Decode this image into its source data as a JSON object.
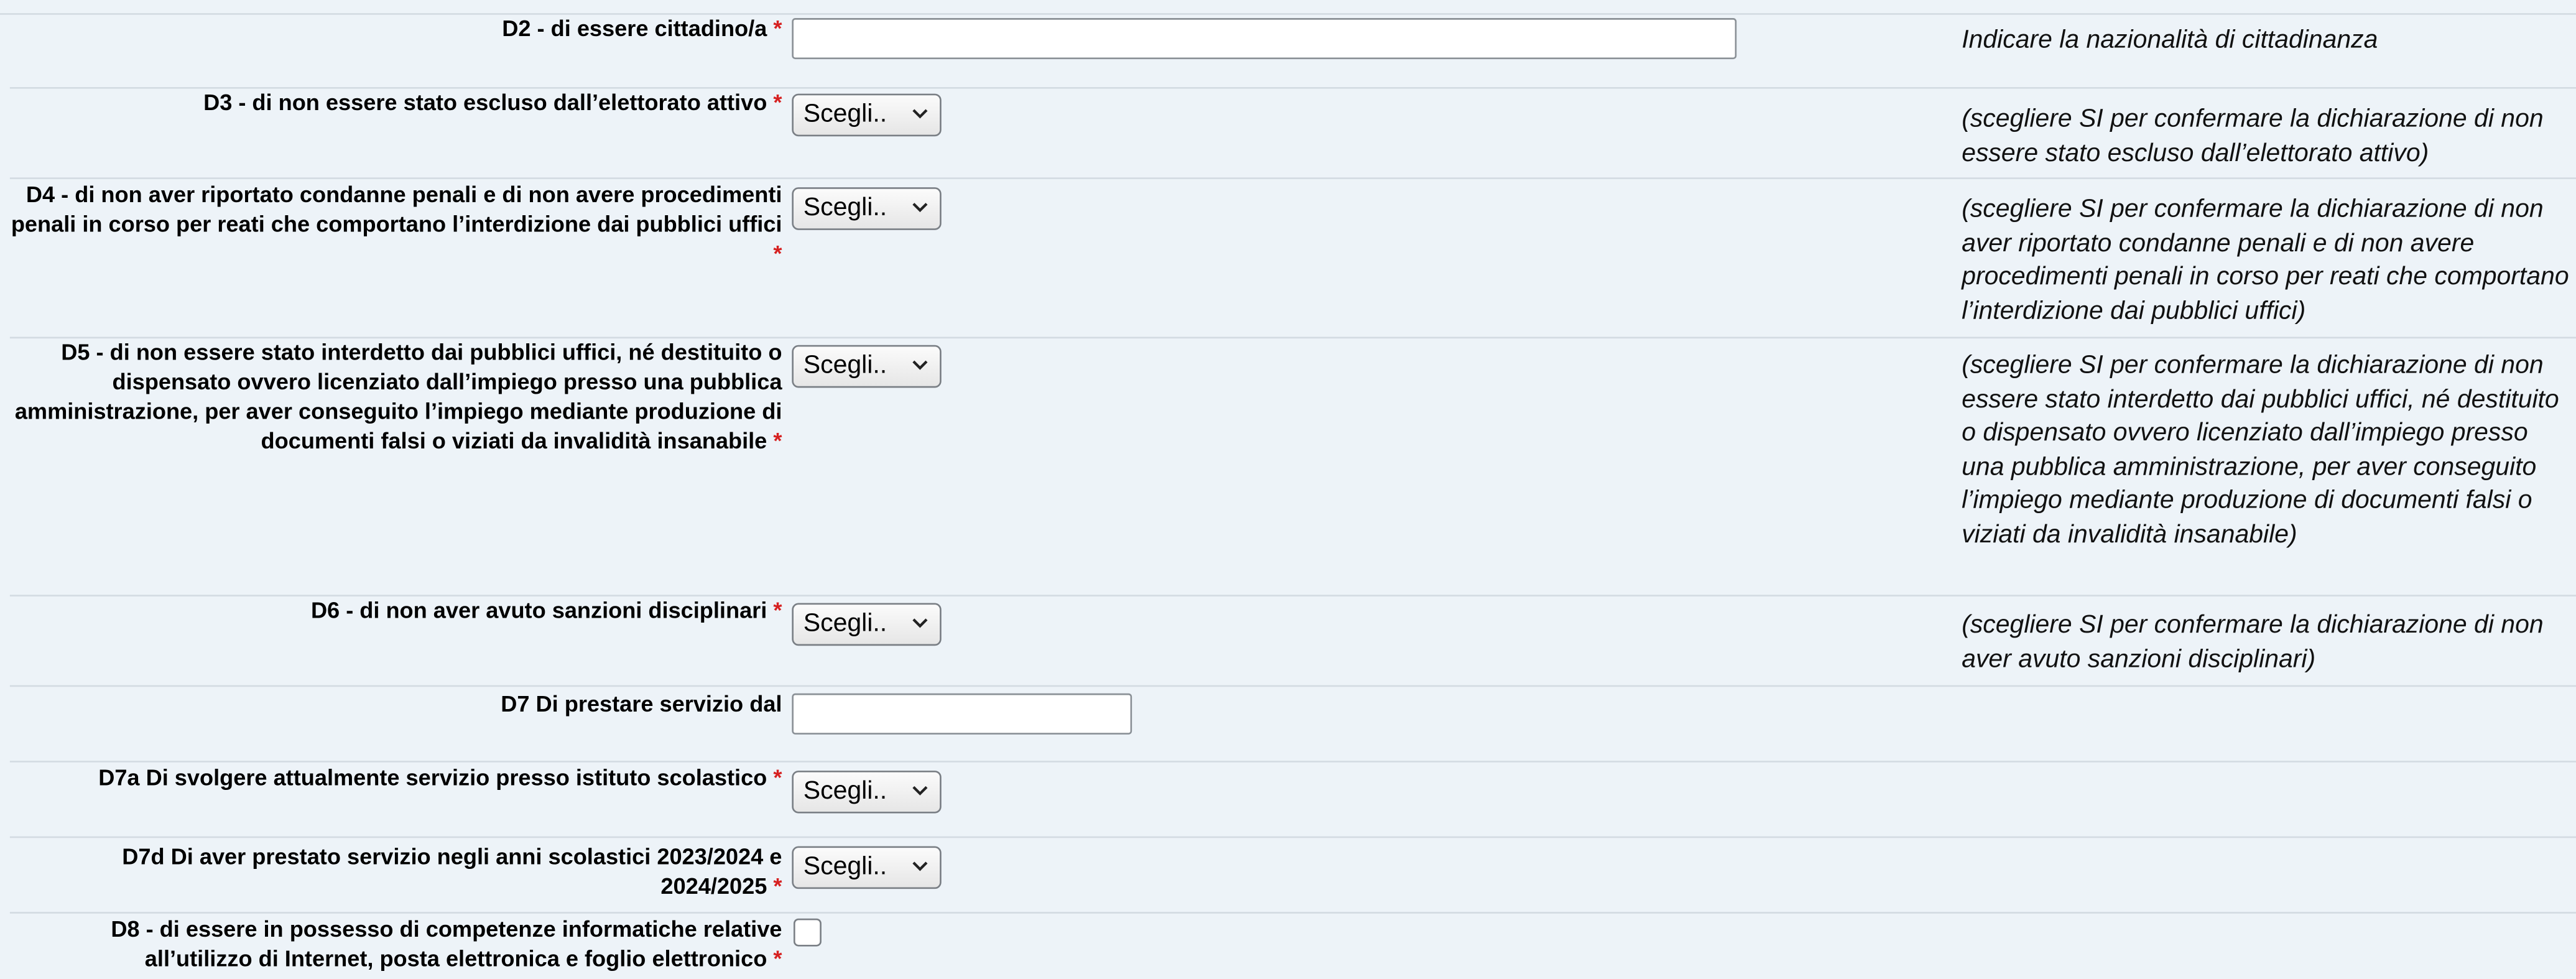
{
  "rows": [
    {
      "label": "D2 - di essere cittadino/a",
      "required": "*",
      "hint": "Indicare la nazionalità di cittadinanza",
      "input_value": ""
    },
    {
      "label": "D3 - di non essere stato escluso dall’elettorato attivo",
      "required": "*",
      "hint": "(scegliere SI per confermare la dichiarazione di non essere stato escluso dall’elettorato attivo)",
      "select_value": "Scegli.."
    },
    {
      "label": "D4 - di non aver riportato condanne penali e di non avere procedimenti penali in corso per reati che comportano l’interdizione dai pubblici uffici",
      "required": "*",
      "hint": "(scegliere SI per confermare la dichiarazione di non aver riportato condanne penali e di non avere procedimenti penali in corso per reati che comportano l’interdizione dai pubblici uffici)",
      "select_value": "Scegli.."
    },
    {
      "label": "D5 - di non essere stato interdetto dai pubblici uffici, né destituito o dispensato ovvero licenziato dall’impiego presso una pubblica amministrazione, per aver conseguito l’impiego mediante produzione di documenti falsi o viziati da invalidità insanabile",
      "required": "*",
      "hint": "(scegliere SI per confermare la dichiarazione di non essere stato interdetto dai pubblici uffici, né destituito o dispensato ovvero licenziato dall’impiego presso una pubblica amministrazione, per aver conseguito l’impiego mediante produzione di documenti falsi o viziati da invalidità insanabile)",
      "select_value": "Scegli.."
    },
    {
      "label": "D6 - di non aver avuto sanzioni disciplinari",
      "required": "*",
      "hint": "(scegliere SI per confermare la dichiarazione di non aver avuto sanzioni disciplinari)",
      "select_value": "Scegli.."
    },
    {
      "label": "D7 Di prestare servizio dal",
      "required": "",
      "input_value": ""
    },
    {
      "label": "D7a Di svolgere attualmente servizio presso istituto scolastico",
      "required": "*",
      "select_value": "Scegli.."
    },
    {
      "label": "D7d Di aver prestato servizio negli anni scolastici 2023/2024 e 2024/2025",
      "required": "*",
      "select_value": "Scegli.."
    },
    {
      "label": "D8 - di essere in possesso di competenze informatiche relative all’utilizzo di Internet, posta elettronica e foglio elettronico",
      "required": "*",
      "checked": false
    }
  ],
  "icons": {
    "select_arrow": "chevron-down-icon"
  },
  "colors": {
    "background": "#edf3f8",
    "required": "#d62020",
    "divider": "#d3dbe2"
  }
}
